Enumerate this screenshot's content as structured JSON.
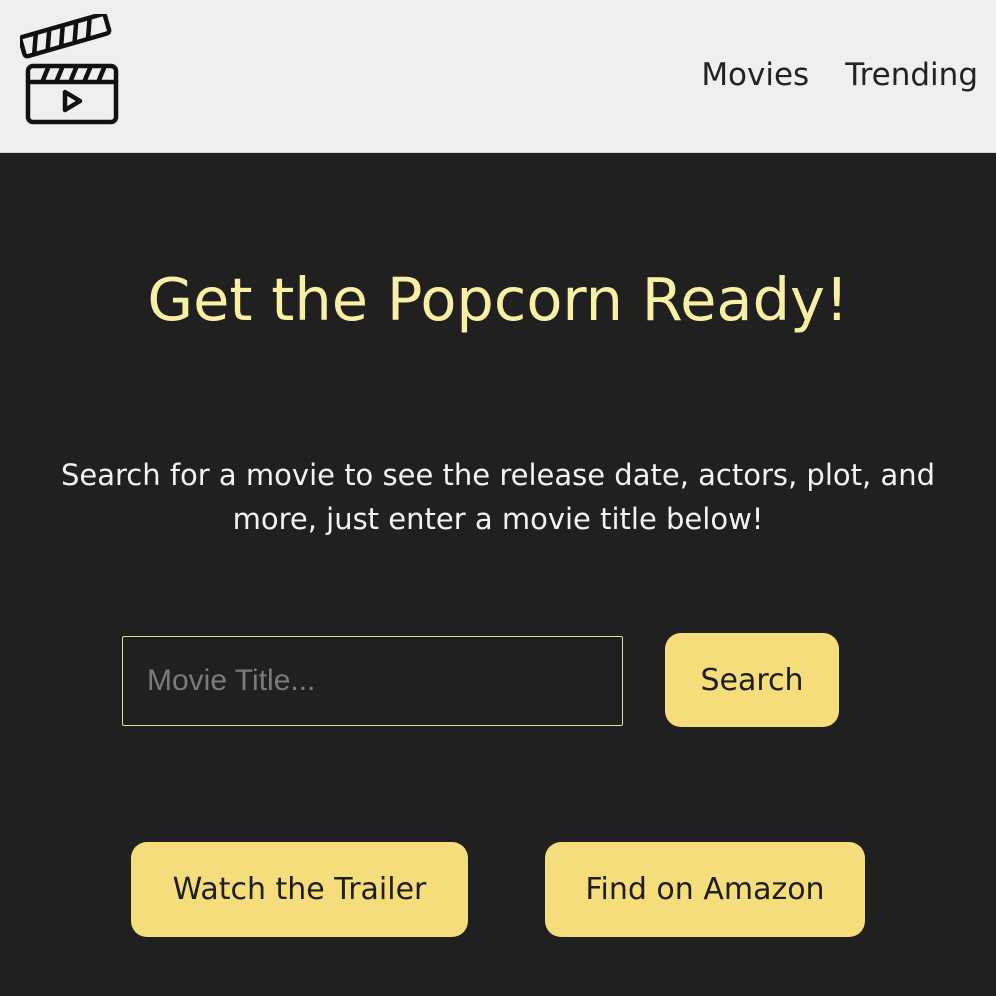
{
  "header": {
    "logo_icon": "clapperboard-play-icon",
    "nav": [
      {
        "label": "Movies"
      },
      {
        "label": "Trending"
      }
    ]
  },
  "hero": {
    "title": "Get the Popcorn Ready!",
    "description": "Search for a movie to see the release date, actors, plot, and more, just enter a movie title below!"
  },
  "search": {
    "placeholder": "Movie Title...",
    "value": "",
    "button_label": "Search"
  },
  "actions": {
    "trailer_label": "Watch the Trailer",
    "amazon_label": "Find on Amazon"
  },
  "colors": {
    "header_bg": "#efefef",
    "page_bg": "#202020",
    "title": "#f9f0a6",
    "button_bg": "#f5dd7c",
    "input_border": "#e6dc9c"
  }
}
